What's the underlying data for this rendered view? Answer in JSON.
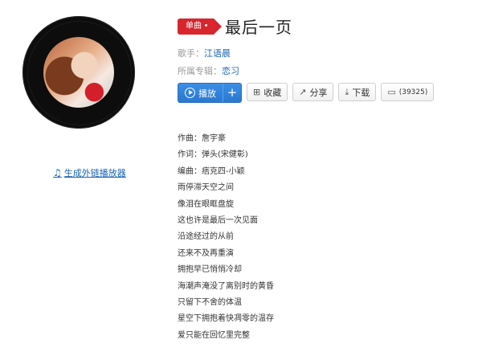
{
  "cover": {
    "alt": "album-cover"
  },
  "generate_player_link": "生成外链播放器",
  "song": {
    "badge": "单曲",
    "title": "最后一页"
  },
  "meta": {
    "singer_label": "歌手：",
    "singer": "江语晨",
    "album_label": "所属专辑：",
    "album": "恋习"
  },
  "actions": {
    "play": "播放",
    "plus": "+",
    "collect": "收藏",
    "share": "分享",
    "download": "下载",
    "comments": "(39325)"
  },
  "icons": {
    "play": "play-circle-icon",
    "collect": "collect-folder-icon",
    "share": "share-arrow-icon",
    "download": "download-icon",
    "comment": "comment-bubble-icon",
    "note": "music-note-icon"
  },
  "lyrics": [
    "作曲：詹宇豪",
    "作词：弹头(宋健彰)",
    "编曲：痞克四-小颖",
    "雨停滞天空之间",
    "像泪在眼眶盘旋",
    "这也许是最后一次见面",
    "沿途经过的从前",
    "还来不及再重演",
    "拥抱早已悄悄冷却",
    "海潮声淹没了离别时的黄昏",
    "只留下不舍的体温",
    "星空下拥抱着快凋零的温存",
    "爱只能在回忆里完整"
  ],
  "colors": {
    "accent": "#d7262e",
    "link": "#1a63b8",
    "button": "#2a78d0"
  }
}
